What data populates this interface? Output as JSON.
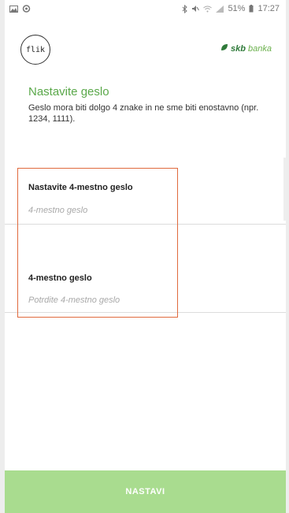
{
  "status_bar": {
    "left_icons": [
      "gallery-icon",
      "notification-icon"
    ],
    "battery": "51%",
    "time": "17:27"
  },
  "header": {
    "app_logo": "flik",
    "bank_logo_part1": "skb",
    "bank_logo_part2": "banka"
  },
  "intro": {
    "title": "Nastavite geslo",
    "description": "Geslo mora biti dolgo 4 znake in ne sme biti enostavno (npr. 1234, 1111)."
  },
  "form": {
    "pin_label": "Nastavite 4-mestno geslo",
    "pin_placeholder": "4-mestno geslo",
    "confirm_label": "4-mestno geslo",
    "confirm_placeholder": "Potrdite 4-mestno geslo"
  },
  "footer": {
    "continue_label": "NASTAVI"
  },
  "colors": {
    "accent_green": "#5aa84a",
    "button_green": "#a9dc8f",
    "highlight": "#e06a3e"
  }
}
